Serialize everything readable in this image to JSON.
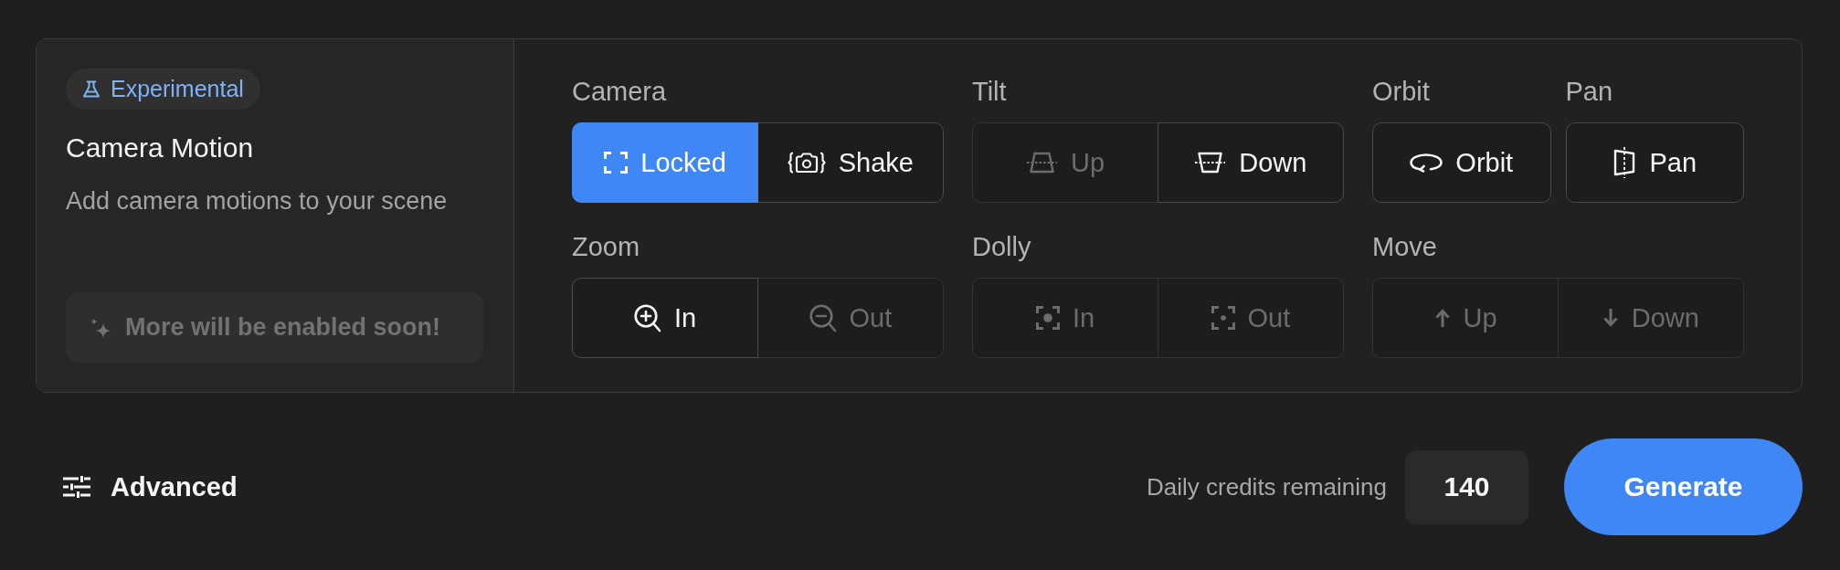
{
  "feature": {
    "badge": "Experimental",
    "title": "Camera Motion",
    "description": "Add camera motions to your scene",
    "notice": "More will be enabled soon!"
  },
  "controls": {
    "rows": [
      {
        "groups": [
          {
            "label": "Camera",
            "options": [
              {
                "label": "Locked",
                "selected": true,
                "disabled": false
              },
              {
                "label": "Shake",
                "selected": false,
                "disabled": false
              }
            ]
          },
          {
            "label": "Tilt",
            "options": [
              {
                "label": "Up",
                "selected": false,
                "disabled": true
              },
              {
                "label": "Down",
                "selected": false,
                "disabled": false
              }
            ]
          },
          {
            "label": "Orbit",
            "options": [
              {
                "label": "Orbit",
                "selected": false,
                "disabled": false
              }
            ]
          },
          {
            "label": "Pan",
            "options": [
              {
                "label": "Pan",
                "selected": false,
                "disabled": false
              }
            ]
          }
        ]
      },
      {
        "groups": [
          {
            "label": "Zoom",
            "options": [
              {
                "label": "In",
                "selected": false,
                "disabled": false
              },
              {
                "label": "Out",
                "selected": false,
                "disabled": true
              }
            ]
          },
          {
            "label": "Dolly",
            "options": [
              {
                "label": "In",
                "selected": false,
                "disabled": true
              },
              {
                "label": "Out",
                "selected": false,
                "disabled": true
              }
            ]
          },
          {
            "label": "Move",
            "options": [
              {
                "label": "Up",
                "selected": false,
                "disabled": true
              },
              {
                "label": "Down",
                "selected": false,
                "disabled": true
              }
            ]
          }
        ]
      }
    ]
  },
  "footer": {
    "advanced": "Advanced",
    "credits_label": "Daily credits remaining",
    "credits": "140",
    "generate": "Generate"
  }
}
